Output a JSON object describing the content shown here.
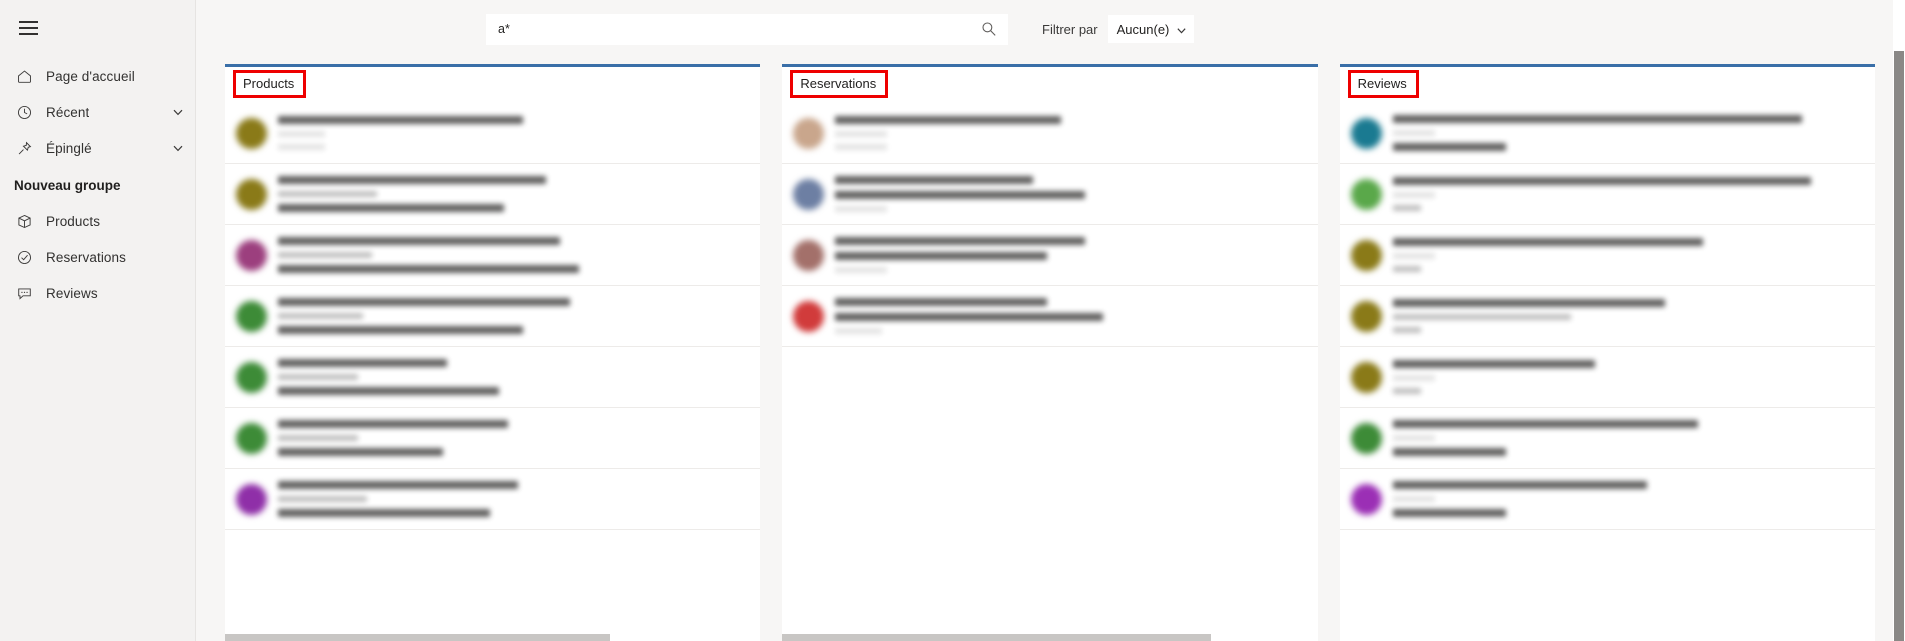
{
  "sidebar": {
    "hamburger_name": "hamburger-menu",
    "items": [
      {
        "label": "Page d'accueil",
        "icon": "home-icon",
        "chevron": false
      },
      {
        "label": "Récent",
        "icon": "clock-icon",
        "chevron": true
      },
      {
        "label": "Épinglé",
        "icon": "pin-icon",
        "chevron": true
      }
    ],
    "group_title": "Nouveau groupe",
    "group_items": [
      {
        "label": "Products",
        "icon": "box-icon"
      },
      {
        "label": "Reservations",
        "icon": "check-circle-icon"
      },
      {
        "label": "Reviews",
        "icon": "comment-icon"
      }
    ]
  },
  "topbar": {
    "search_value": "a*",
    "search_placeholder": "",
    "search_icon": "search-icon",
    "filter_label": "Filtrer par",
    "filter_value": "Aucun(e)",
    "filter_options": [
      "Aucun(e)"
    ],
    "chevron_icon": "chevron-down-icon"
  },
  "colors": {
    "panel_top_border": "#3a6fa8",
    "highlight_outline": "#ee0000",
    "sidebar_bg": "#f3f2f1",
    "canvas_bg": "#f7f6f5",
    "scrollbar_thumb": "#8a8886"
  },
  "panels": [
    {
      "title": "Products",
      "highlighted": true,
      "has_hscroll": true,
      "rows": [
        {
          "avatar": "#8a7a18",
          "avatar_type": "initials",
          "lines": [
            {
              "w": "52%",
              "t": "main"
            },
            {
              "w": "10%",
              "t": "faint"
            },
            {
              "w": "10%",
              "t": "faint"
            }
          ]
        },
        {
          "avatar": "#8a7a18",
          "avatar_type": "initials",
          "lines": [
            {
              "w": "57%",
              "t": "main"
            },
            {
              "w": "21%",
              "t": "sub"
            },
            {
              "w": "48%",
              "t": "main"
            }
          ]
        },
        {
          "avatar": "#9c3f7e",
          "avatar_type": "initials",
          "lines": [
            {
              "w": "60%",
              "t": "main"
            },
            {
              "w": "20%",
              "t": "sub"
            },
            {
              "w": "64%",
              "t": "main"
            }
          ]
        },
        {
          "avatar": "#3d8b37",
          "avatar_type": "initials",
          "lines": [
            {
              "w": "62%",
              "t": "main"
            },
            {
              "w": "18%",
              "t": "sub"
            },
            {
              "w": "52%",
              "t": "main"
            }
          ]
        },
        {
          "avatar": "#3d8b37",
          "avatar_type": "initials",
          "lines": [
            {
              "w": "36%",
              "t": "main"
            },
            {
              "w": "17%",
              "t": "sub"
            },
            {
              "w": "47%",
              "t": "main"
            }
          ]
        },
        {
          "avatar": "#3d8b37",
          "avatar_type": "initials",
          "lines": [
            {
              "w": "49%",
              "t": "main"
            },
            {
              "w": "17%",
              "t": "sub"
            },
            {
              "w": "35%",
              "t": "main"
            }
          ]
        },
        {
          "avatar": "#8f2fa8",
          "avatar_type": "initials",
          "lines": [
            {
              "w": "51%",
              "t": "main"
            },
            {
              "w": "19%",
              "t": "sub"
            },
            {
              "w": "45%",
              "t": "main"
            }
          ]
        }
      ]
    },
    {
      "title": "Reservations",
      "highlighted": true,
      "has_hscroll": true,
      "rows": [
        {
          "avatar": "#c9a68c",
          "avatar_type": "photo",
          "lines": [
            {
              "w": "48%",
              "t": "main"
            },
            {
              "w": "11%",
              "t": "faint"
            },
            {
              "w": "11%",
              "t": "faint"
            }
          ]
        },
        {
          "avatar": "#6d7fa3",
          "avatar_type": "photo",
          "lines": [
            {
              "w": "42%",
              "t": "main"
            },
            {
              "w": "53%",
              "t": "main"
            },
            {
              "w": "11%",
              "t": "faint"
            }
          ]
        },
        {
          "avatar": "#a3706a",
          "avatar_type": "photo",
          "lines": [
            {
              "w": "53%",
              "t": "main"
            },
            {
              "w": "45%",
              "t": "main"
            },
            {
              "w": "11%",
              "t": "faint"
            }
          ]
        },
        {
          "avatar": "#d13b3b",
          "avatar_type": "initials",
          "lines": [
            {
              "w": "45%",
              "t": "main"
            },
            {
              "w": "57%",
              "t": "main"
            },
            {
              "w": "10%",
              "t": "faint"
            }
          ]
        }
      ]
    },
    {
      "title": "Reviews",
      "highlighted": true,
      "has_hscroll": false,
      "rows": [
        {
          "avatar": "#1a7a91",
          "avatar_type": "initials",
          "lines": [
            {
              "w": "87%",
              "t": "main"
            },
            {
              "w": "9%",
              "t": "faint"
            },
            {
              "w": "24%",
              "t": "main"
            }
          ]
        },
        {
          "avatar": "#5aa84a",
          "avatar_type": "initials",
          "lines": [
            {
              "w": "89%",
              "t": "main"
            },
            {
              "w": "9%",
              "t": "faint"
            },
            {
              "w": "6%",
              "t": "sub"
            }
          ]
        },
        {
          "avatar": "#8a7a18",
          "avatar_type": "initials",
          "lines": [
            {
              "w": "66%",
              "t": "main"
            },
            {
              "w": "9%",
              "t": "faint"
            },
            {
              "w": "6%",
              "t": "sub"
            }
          ]
        },
        {
          "avatar": "#8a7a18",
          "avatar_type": "initials",
          "lines": [
            {
              "w": "58%",
              "t": "main"
            },
            {
              "w": "38%",
              "t": "sub"
            },
            {
              "w": "6%",
              "t": "sub"
            }
          ]
        },
        {
          "avatar": "#8a7a18",
          "avatar_type": "initials",
          "lines": [
            {
              "w": "43%",
              "t": "main"
            },
            {
              "w": "9%",
              "t": "faint"
            },
            {
              "w": "6%",
              "t": "sub"
            }
          ]
        },
        {
          "avatar": "#3d8b37",
          "avatar_type": "initials",
          "lines": [
            {
              "w": "65%",
              "t": "main"
            },
            {
              "w": "9%",
              "t": "faint"
            },
            {
              "w": "24%",
              "t": "main"
            }
          ]
        },
        {
          "avatar": "#9b2fb5",
          "avatar_type": "initials",
          "lines": [
            {
              "w": "54%",
              "t": "main"
            },
            {
              "w": "9%",
              "t": "faint"
            },
            {
              "w": "24%",
              "t": "main"
            }
          ]
        }
      ]
    }
  ],
  "scrollbar": {
    "thumb_top_pct": 8,
    "thumb_height_pct": 92
  }
}
